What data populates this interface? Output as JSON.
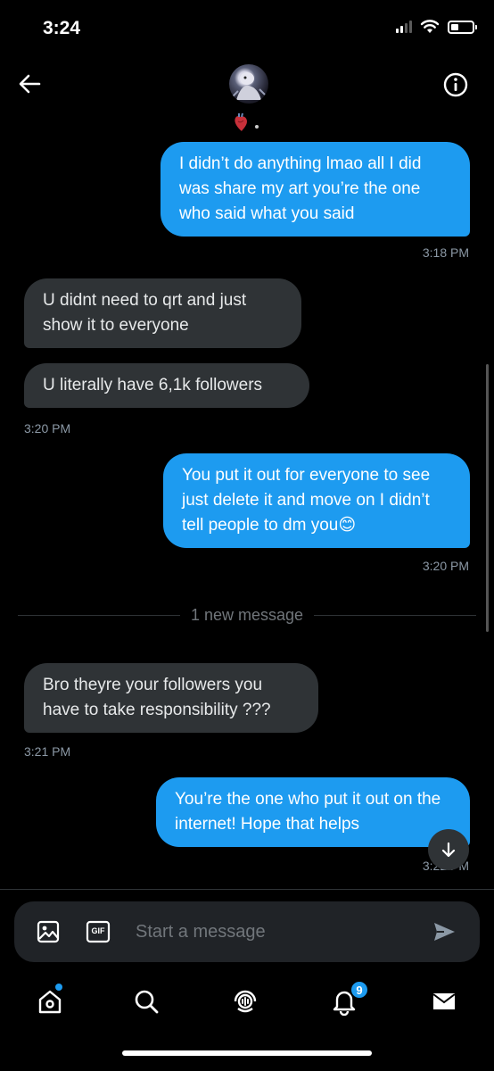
{
  "status_bar": {
    "time": "3:24"
  },
  "header": {
    "back_icon": "arrow-left-icon",
    "info_icon": "info-circle-icon",
    "name_emoji": "anatomical-heart-icon"
  },
  "messages": [
    {
      "direction": "outgoing",
      "text": "I didn’t do anything lmao all I did was share my art you’re the one who said what you said"
    },
    {
      "direction": "outgoing",
      "timestamp": "3:18 PM"
    },
    {
      "direction": "incoming",
      "text": "U didnt need to qrt and just show it to everyone"
    },
    {
      "direction": "incoming",
      "text": "U literally have 6,1k followers"
    },
    {
      "direction": "incoming",
      "timestamp": "3:20 PM"
    },
    {
      "direction": "outgoing",
      "text": "You put it out for everyone to see just delete it and move on I didn’t tell people to dm you😊"
    },
    {
      "direction": "outgoing",
      "timestamp": "3:20 PM"
    },
    {
      "direction": "incoming",
      "text": "Bro theyre your followers you have to take responsibility ???"
    },
    {
      "direction": "incoming",
      "timestamp": "3:21 PM"
    },
    {
      "direction": "outgoing",
      "text": "You’re the one who put it out on the internet! Hope that helps"
    },
    {
      "direction": "outgoing",
      "timestamp": "3:22 PM"
    }
  ],
  "divider": {
    "label": "1 new message"
  },
  "composer": {
    "placeholder": "Start a message",
    "gif_label": "GIF"
  },
  "tabbar": {
    "items": [
      "home-icon",
      "search-icon",
      "spaces-icon",
      "notifications-icon",
      "messages-icon"
    ],
    "notification_count": "9"
  },
  "colors": {
    "accent": "#1d9bf0",
    "incoming_bubble": "#2f3336",
    "background": "#000000"
  }
}
